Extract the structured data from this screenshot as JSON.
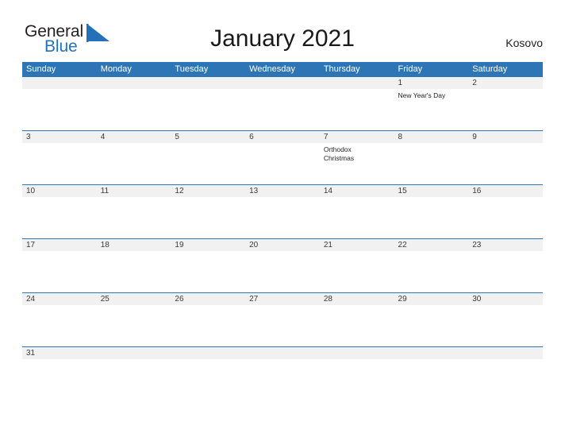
{
  "brand": {
    "name_part1": "General",
    "name_part2": "Blue",
    "flag_icon": "triangle-flag-icon",
    "color_primary": "#2372b9",
    "color_text": "#231f20"
  },
  "header": {
    "title": "January 2021",
    "country": "Kosovo"
  },
  "theme": {
    "header_blue": "#2e75b6",
    "date_band_gray": "#f1f1f1",
    "rule_blue": "#2e75b6",
    "page_background": "#ffffff"
  },
  "calendar": {
    "month": "January",
    "year": "2021",
    "weekdays": [
      "Sunday",
      "Monday",
      "Tuesday",
      "Wednesday",
      "Thursday",
      "Friday",
      "Saturday"
    ],
    "weeks": [
      {
        "days": [
          {
            "date": "",
            "event": ""
          },
          {
            "date": "",
            "event": ""
          },
          {
            "date": "",
            "event": ""
          },
          {
            "date": "",
            "event": ""
          },
          {
            "date": "",
            "event": ""
          },
          {
            "date": "1",
            "event": "New Year's Day"
          },
          {
            "date": "2",
            "event": ""
          }
        ]
      },
      {
        "days": [
          {
            "date": "3",
            "event": ""
          },
          {
            "date": "4",
            "event": ""
          },
          {
            "date": "5",
            "event": ""
          },
          {
            "date": "6",
            "event": ""
          },
          {
            "date": "7",
            "event": "Orthodox Christmas"
          },
          {
            "date": "8",
            "event": ""
          },
          {
            "date": "9",
            "event": ""
          }
        ]
      },
      {
        "days": [
          {
            "date": "10",
            "event": ""
          },
          {
            "date": "11",
            "event": ""
          },
          {
            "date": "12",
            "event": ""
          },
          {
            "date": "13",
            "event": ""
          },
          {
            "date": "14",
            "event": ""
          },
          {
            "date": "15",
            "event": ""
          },
          {
            "date": "16",
            "event": ""
          }
        ]
      },
      {
        "days": [
          {
            "date": "17",
            "event": ""
          },
          {
            "date": "18",
            "event": ""
          },
          {
            "date": "19",
            "event": ""
          },
          {
            "date": "20",
            "event": ""
          },
          {
            "date": "21",
            "event": ""
          },
          {
            "date": "22",
            "event": ""
          },
          {
            "date": "23",
            "event": ""
          }
        ]
      },
      {
        "days": [
          {
            "date": "24",
            "event": ""
          },
          {
            "date": "25",
            "event": ""
          },
          {
            "date": "26",
            "event": ""
          },
          {
            "date": "27",
            "event": ""
          },
          {
            "date": "28",
            "event": ""
          },
          {
            "date": "29",
            "event": ""
          },
          {
            "date": "30",
            "event": ""
          }
        ]
      },
      {
        "days": [
          {
            "date": "31",
            "event": ""
          },
          {
            "date": "",
            "event": ""
          },
          {
            "date": "",
            "event": ""
          },
          {
            "date": "",
            "event": ""
          },
          {
            "date": "",
            "event": ""
          },
          {
            "date": "",
            "event": ""
          },
          {
            "date": "",
            "event": ""
          }
        ]
      }
    ]
  }
}
